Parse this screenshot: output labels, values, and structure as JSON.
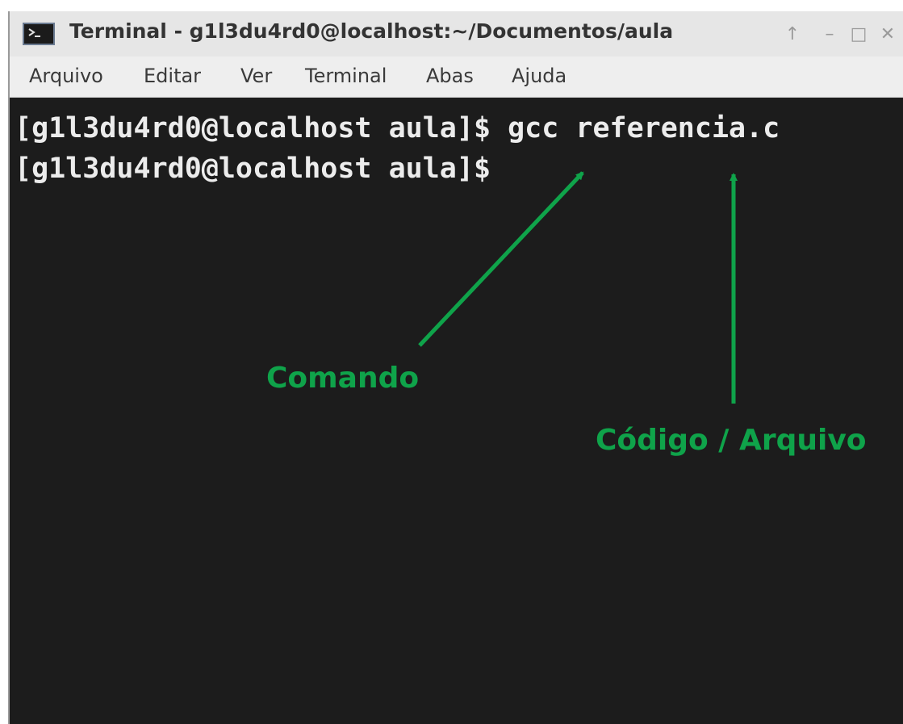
{
  "window": {
    "title": "Terminal - g1l3du4rd0@localhost:~/Documentos/aula",
    "buttons": {
      "up": "↑",
      "minimize": "–",
      "maximize": "□",
      "close": "✕"
    }
  },
  "menu": [
    "Arquivo",
    "Editar",
    "Ver",
    "Terminal",
    "Abas",
    "Ajuda"
  ],
  "terminal": {
    "lines": [
      "[g1l3du4rd0@localhost aula]$ gcc referencia.c",
      "[g1l3du4rd0@localhost aula]$"
    ]
  },
  "annotations": {
    "command": "Comando",
    "file": "Código / Arquivo",
    "color": "#0fa34a"
  }
}
